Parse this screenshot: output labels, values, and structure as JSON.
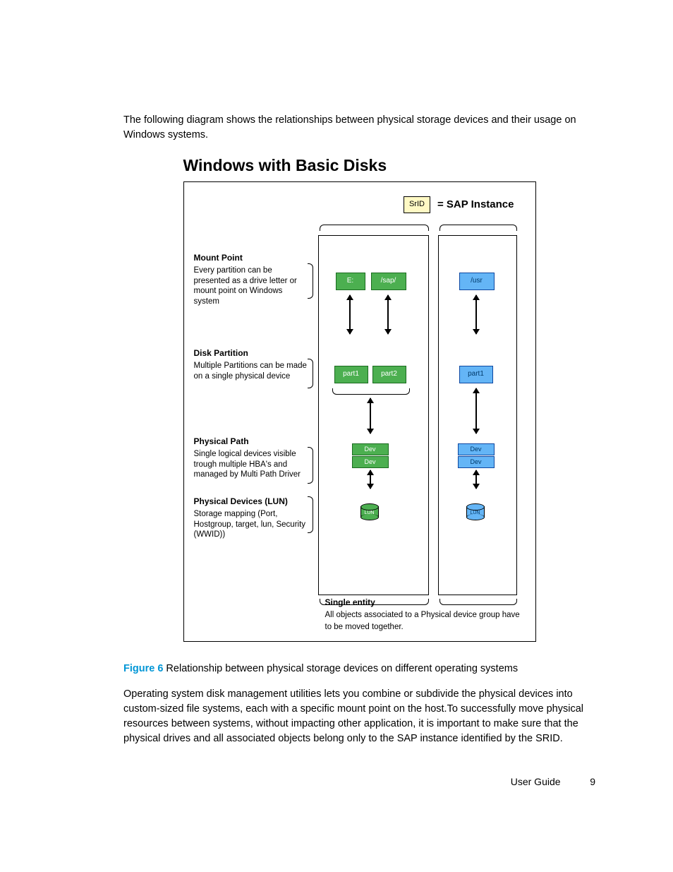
{
  "intro": "The following diagram shows the relationships between physical storage devices and their usage on Windows systems.",
  "diagram": {
    "title": "Windows with Basic Disks",
    "legend": {
      "srid": "SrID",
      "equals": "= SAP Instance"
    },
    "sections": {
      "mount": {
        "h": "Mount Point",
        "t": "Every partition can be presented as a drive letter or mount point on Windows system"
      },
      "part": {
        "h": "Disk Partition",
        "t": "Multiple Partitions can be made on a single physical device"
      },
      "path": {
        "h": "Physical Path",
        "t": "Single logical devices visible trough multiple HBA's and managed by Multi Path Driver"
      },
      "lun": {
        "h": "Physical Devices (LUN)",
        "t": "Storage mapping  (Port, Hostgroup, target, lun, Security (WWID))"
      }
    },
    "colA": {
      "mount1": "E:",
      "mount2": "/sap/",
      "part1": "part1",
      "part2": "part2",
      "dev": "Dev",
      "lun": "LUN"
    },
    "colB": {
      "mount1": "/usr",
      "part1": "part1",
      "dev": "Dev",
      "lun": "LUN"
    },
    "footer": {
      "h": "Single entity",
      "t": "All objects associated to a Physical device group have to be moved together."
    }
  },
  "caption": {
    "label": "Figure 6",
    "text": " Relationship between physical storage devices on different operating systems"
  },
  "body": "Operating system disk management utilities lets you combine or subdivide the physical devices into custom-sized file systems, each with a specific mount point on the host.To successfully move physical resources between systems, without impacting other application, it is important to make sure that the physical drives and all associated objects belong only to the SAP instance identified by the SRID.",
  "footer": {
    "doc": "User Guide",
    "page": "9"
  }
}
